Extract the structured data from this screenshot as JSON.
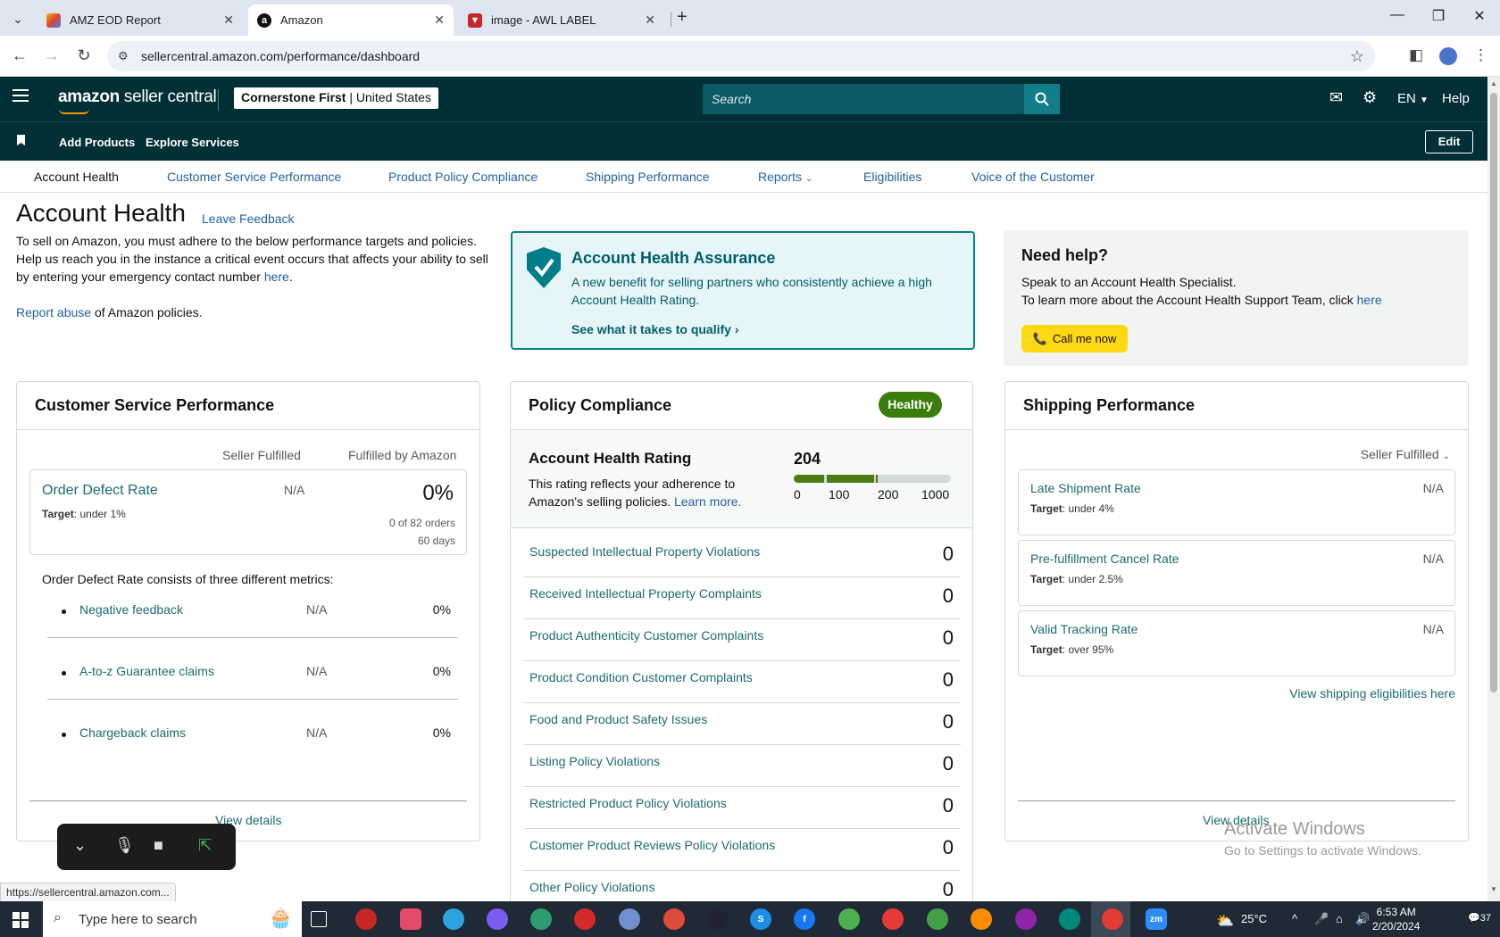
{
  "browser": {
    "tabs": [
      {
        "title": "AMZ EOD Report",
        "active": false
      },
      {
        "title": "Amazon",
        "active": true
      },
      {
        "title": "image - AWL LABEL",
        "active": false
      }
    ],
    "url": "sellercentral.amazon.com/performance/dashboard",
    "status_url": "https://sellercentral.amazon.com..."
  },
  "header": {
    "logo_bold": "amazon",
    "logo_rest": " seller central",
    "store_name": "Cornerstone First",
    "store_sep": " | ",
    "store_country": "United States",
    "search_placeholder": "Search",
    "language": "EN",
    "help": "Help"
  },
  "subnav": {
    "links": [
      "Add Products",
      "Explore Services"
    ],
    "edit": "Edit"
  },
  "page_tabs": [
    "Account Health",
    "Customer Service Performance",
    "Product Policy Compliance",
    "Shipping Performance",
    "Reports",
    "Eligibilities",
    "Voice of the Customer"
  ],
  "page": {
    "title": "Account Health",
    "leave_feedback": "Leave Feedback",
    "intro_1": "To sell on Amazon, you must adhere to the below performance targets and policies.",
    "intro_2": "Help us reach you in the instance a critical event occurs that affects your ability to sell by entering your emergency contact number ",
    "intro_2_link": "here",
    "intro_2_end": ".",
    "report_abuse": "Report abuse",
    "report_abuse_rest": " of Amazon policies."
  },
  "aha": {
    "title": "Account Health Assurance",
    "text": "A new benefit for selling partners who consistently achieve a high Account Health Rating.",
    "link": "See what it takes to qualify"
  },
  "help_box": {
    "title": "Need help?",
    "line1": "Speak to an Account Health Specialist.",
    "line2": "To learn more about the Account Health Support Team, click ",
    "line2_link": "here",
    "call_button": "Call me now"
  },
  "csp": {
    "title": "Customer Service Performance",
    "col_seller": "Seller Fulfilled",
    "col_fba": "Fulfilled by Amazon",
    "odr": {
      "name": "Order Defect Rate",
      "target_label": "Target",
      "target_value": ": under 1%",
      "seller_value": "N/A",
      "fba_value": "0%",
      "orders": "0 of 82 orders",
      "days": "60 days"
    },
    "consists_text": "Order Defect Rate consists of three different metrics:",
    "metrics": [
      {
        "name": "Negative feedback",
        "seller": "N/A",
        "fba": "0%"
      },
      {
        "name": "A-to-z Guarantee claims",
        "seller": "N/A",
        "fba": "0%"
      },
      {
        "name": "Chargeback claims",
        "seller": "N/A",
        "fba": "0%"
      }
    ],
    "view_details": "View details"
  },
  "policy": {
    "title": "Policy Compliance",
    "status": "Healthy",
    "ahr_title": "Account Health Rating",
    "ahr_text": "This rating reflects your adherence to Amazon's selling policies. ",
    "ahr_link": "Learn more.",
    "score": "204",
    "scale": [
      "0",
      "100",
      "200",
      "1000"
    ],
    "violations": [
      {
        "name": "Suspected Intellectual Property Violations",
        "count": "0"
      },
      {
        "name": "Received Intellectual Property Complaints",
        "count": "0"
      },
      {
        "name": "Product Authenticity Customer Complaints",
        "count": "0"
      },
      {
        "name": "Product Condition Customer Complaints",
        "count": "0"
      },
      {
        "name": "Food and Product Safety Issues",
        "count": "0"
      },
      {
        "name": "Listing Policy Violations",
        "count": "0"
      },
      {
        "name": "Restricted Product Policy Violations",
        "count": "0"
      },
      {
        "name": "Customer Product Reviews Policy Violations",
        "count": "0"
      },
      {
        "name": "Other Policy Violations",
        "count": "0"
      }
    ]
  },
  "shipping": {
    "title": "Shipping Performance",
    "selector": "Seller Fulfilled",
    "metrics": [
      {
        "name": "Late Shipment Rate",
        "target_label": "Target",
        "target_value": ": under 4%",
        "value": "N/A"
      },
      {
        "name": "Pre-fulfillment Cancel Rate",
        "target_label": "Target",
        "target_value": ": under 2.5%",
        "value": "N/A"
      },
      {
        "name": "Valid Tracking Rate",
        "target_label": "Target",
        "target_value": ": over 95%",
        "value": "N/A"
      }
    ],
    "eligibility_link": "View shipping eligibilities here",
    "view_details": "View details"
  },
  "activate_windows": {
    "line1": "Activate Windows",
    "line2": "Go to Settings to activate Windows."
  },
  "taskbar": {
    "search_placeholder": "Type here to search",
    "weather": "25°C",
    "time": "6:53 AM",
    "date": "2/20/2024",
    "notifications": "37"
  }
}
